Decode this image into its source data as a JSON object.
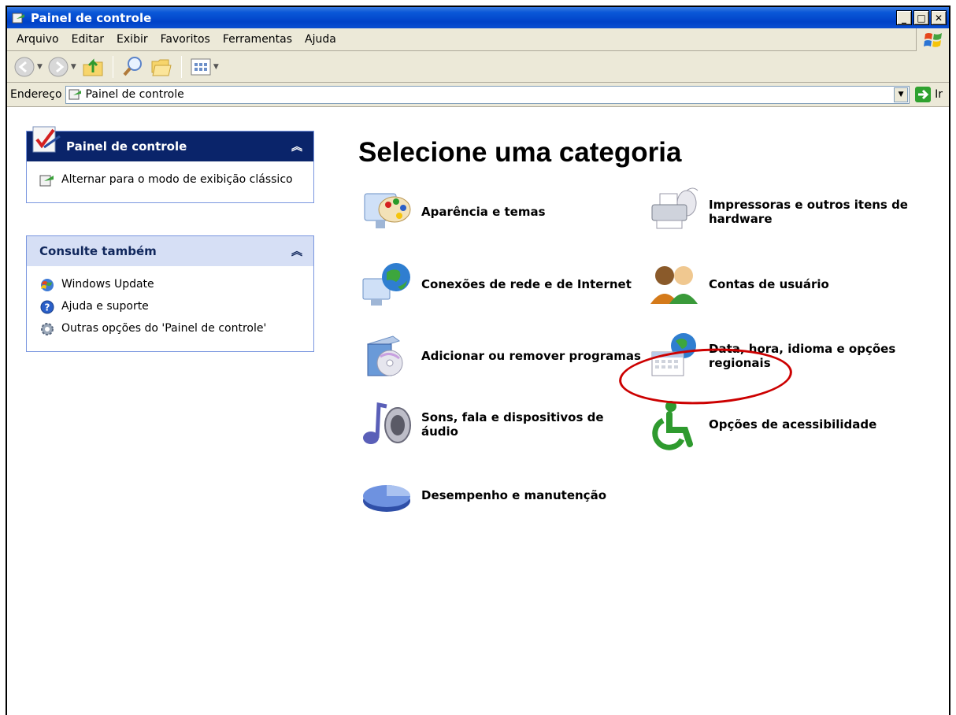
{
  "window": {
    "title": "Painel de controle"
  },
  "title_buttons": {
    "min": "_",
    "max": "□",
    "close": "✕"
  },
  "menu": [
    "Arquivo",
    "Editar",
    "Exibir",
    "Favoritos",
    "Ferramentas",
    "Ajuda"
  ],
  "address": {
    "label": "Endereço",
    "value": "Painel de controle",
    "go": "Ir"
  },
  "sidebar": {
    "panel1": {
      "title": "Painel de controle",
      "link": "Alternar para o modo de exibição clássico"
    },
    "panel2": {
      "title": "Consulte também",
      "links": [
        "Windows Update",
        "Ajuda e suporte",
        "Outras opções do 'Painel de controle'"
      ]
    }
  },
  "main": {
    "title": "Selecione uma categoria",
    "categories": [
      {
        "label": "Aparência e temas",
        "icon": "appearance-icon"
      },
      {
        "label": "Impressoras e outros itens de hardware",
        "icon": "printer-icon"
      },
      {
        "label": "Conexões de rede e de Internet",
        "icon": "network-icon"
      },
      {
        "label": "Contas de usuário",
        "icon": "users-icon"
      },
      {
        "label": "Adicionar ou remover programas",
        "icon": "add-remove-icon"
      },
      {
        "label": "Data, hora, idioma e opções regionais",
        "icon": "date-globe-icon"
      },
      {
        "label": "Sons, fala e dispositivos de áudio",
        "icon": "speaker-icon"
      },
      {
        "label": "Opções de acessibilidade",
        "icon": "accessibility-icon"
      },
      {
        "label": "Desempenho e manutenção",
        "icon": "pie-chart-icon"
      }
    ]
  },
  "colors": {
    "titlebar": "#0042c8",
    "highlight": "#cc0000",
    "panel_header": "#0a246a"
  }
}
